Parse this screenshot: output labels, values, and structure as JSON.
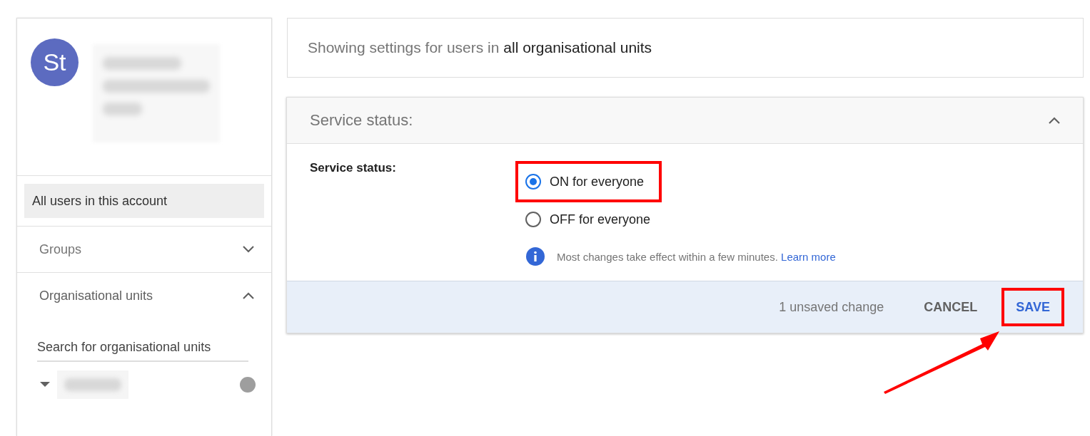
{
  "sidebar": {
    "avatar": {
      "initials": "St"
    },
    "items": [
      {
        "label": "All users in this account",
        "selected": true
      }
    ],
    "sections": [
      {
        "label": "Groups",
        "expanded": false
      },
      {
        "label": "Organisational units",
        "expanded": true
      }
    ],
    "search": {
      "placeholder": "Search for organisational units"
    }
  },
  "scope": {
    "prefix": "Showing settings for users in ",
    "target": "all organisational units"
  },
  "panel": {
    "title": "Service status:",
    "expanded": true,
    "label": "Service status:",
    "options": [
      {
        "label": "ON for everyone",
        "selected": true,
        "highlighted": true
      },
      {
        "label": "OFF for everyone",
        "selected": false,
        "highlighted": false
      }
    ],
    "info": {
      "text": "Most changes take effect within a few minutes.",
      "link": "Learn more"
    },
    "footer": {
      "status": "1 unsaved change",
      "cancel": "CANCEL",
      "save": "SAVE",
      "save_highlighted": true
    }
  }
}
